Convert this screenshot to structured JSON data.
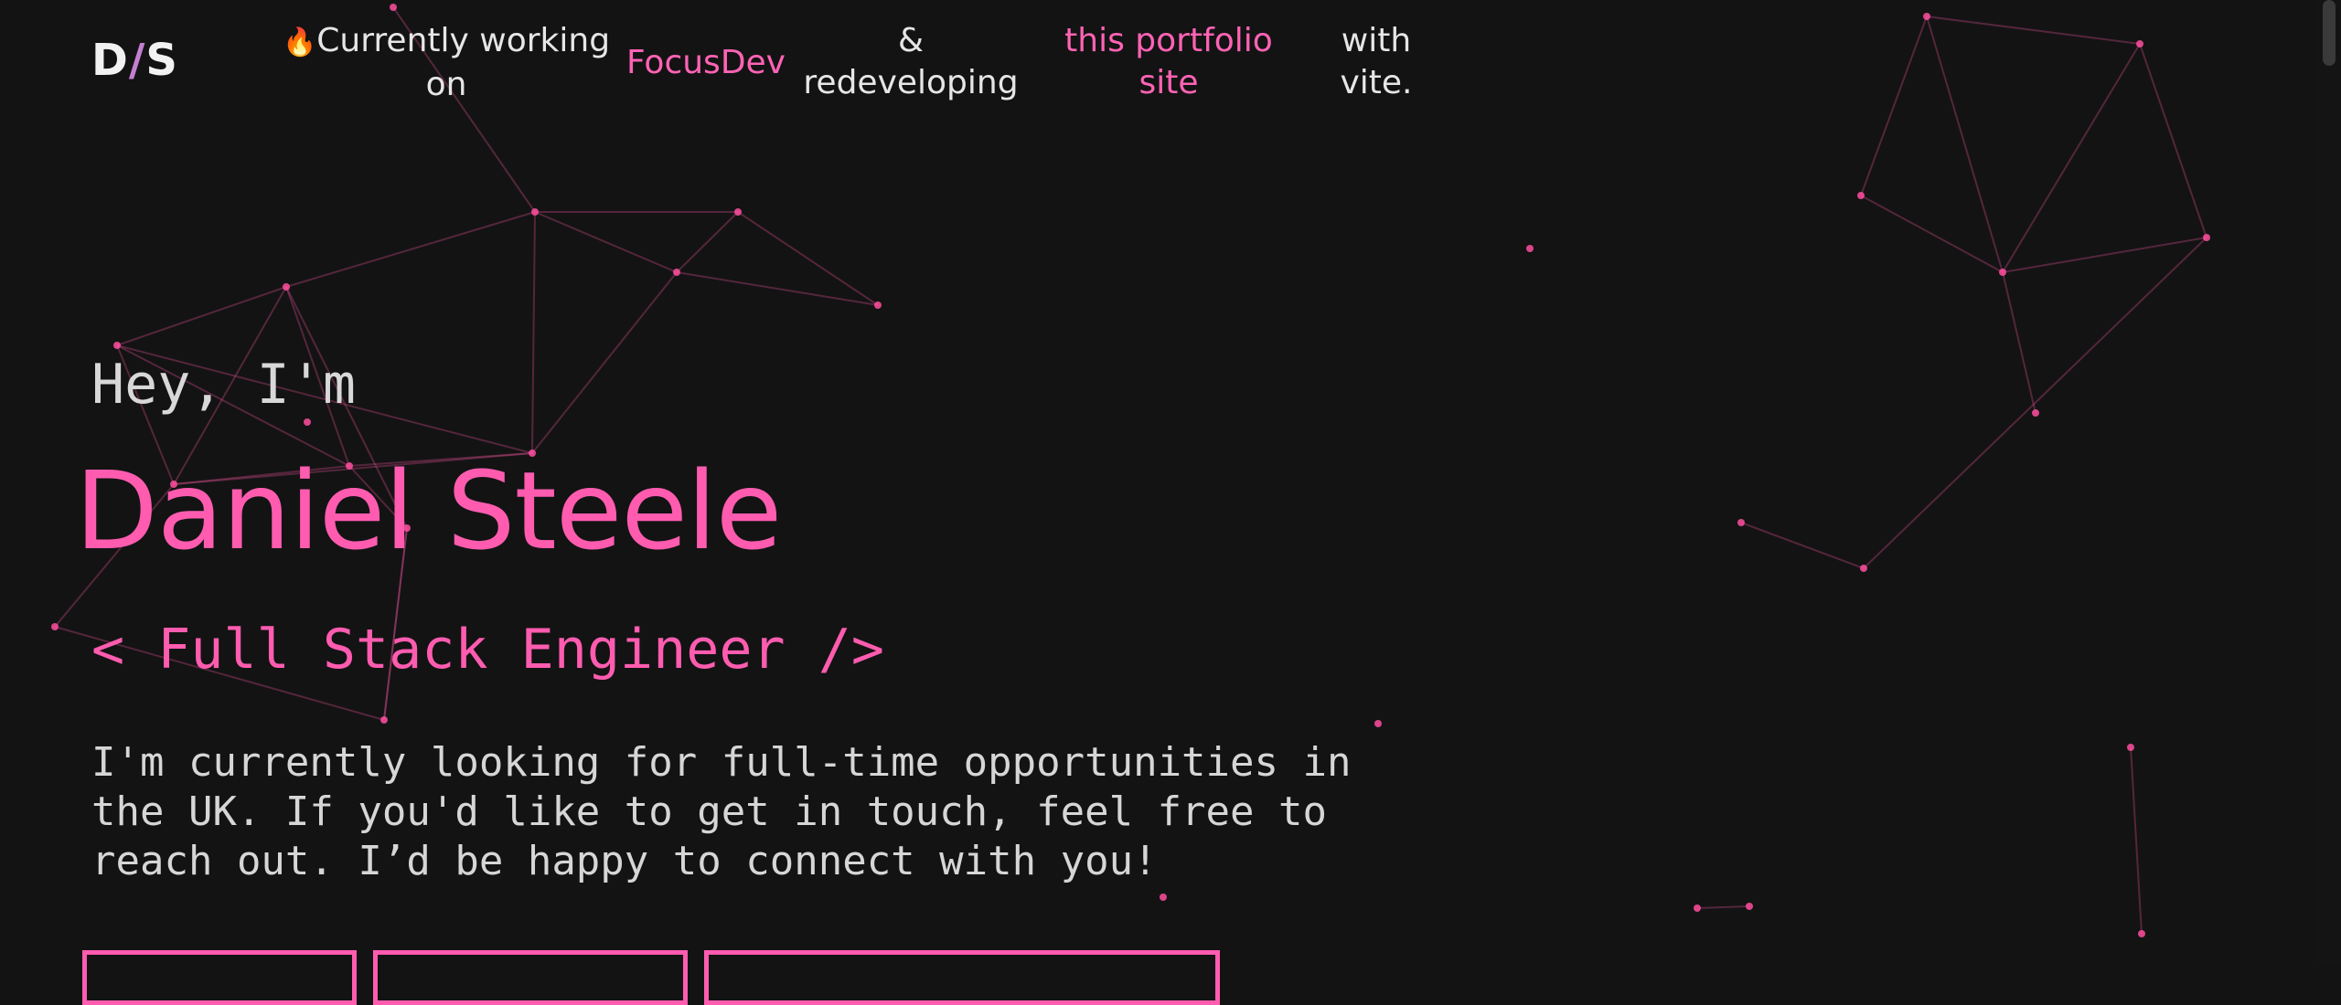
{
  "header": {
    "logo": {
      "left": "D",
      "slash": "/",
      "right": "S"
    },
    "status": [
      {
        "prefix_icon": "🔥",
        "text": "Currently working on",
        "link": false
      },
      {
        "text": "FocusDev",
        "link": true
      },
      {
        "text": "& redeveloping",
        "link": false
      },
      {
        "text": "this portfolio site",
        "link": true
      },
      {
        "text": "with vite.",
        "link": false
      }
    ]
  },
  "hero": {
    "greeting": "Hey, I'm",
    "name": "Daniel Steele",
    "role": "< Full Stack Engineer />",
    "intro": "I'm currently looking for full-time opportunities in\nthe UK. If you'd like to get in touch, feel free to\nreach out. I’d be happy to connect with you!"
  },
  "colors": {
    "background": "#131313",
    "accent": "#ff5cb0",
    "text": "#e6e6e6"
  }
}
